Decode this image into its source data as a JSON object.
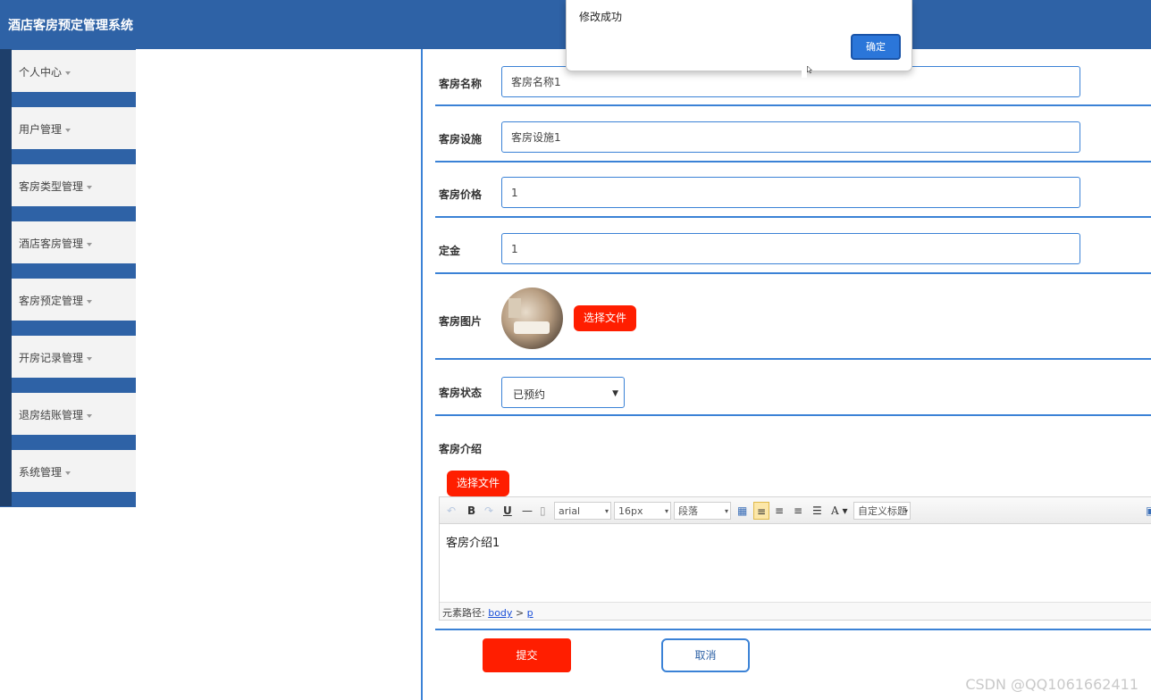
{
  "app": {
    "title": "酒店客房预定管理系统"
  },
  "sidebar": {
    "items": [
      {
        "label": "个人中心"
      },
      {
        "label": "用户管理"
      },
      {
        "label": "客房类型管理"
      },
      {
        "label": "酒店客房管理"
      },
      {
        "label": "客房预定管理"
      },
      {
        "label": "开房记录管理"
      },
      {
        "label": "退房结账管理"
      },
      {
        "label": "系统管理"
      }
    ]
  },
  "form": {
    "room_name": {
      "label": "客房名称",
      "value": "客房名称1"
    },
    "facilities": {
      "label": "客房设施",
      "value": "客房设施1"
    },
    "price": {
      "label": "客房价格",
      "value": "1"
    },
    "deposit": {
      "label": "定金",
      "value": "1"
    },
    "image": {
      "label": "客房图片",
      "upload_label": "选择文件"
    },
    "status": {
      "label": "客房状态",
      "selected": "已预约"
    },
    "intro": {
      "label": "客房介绍",
      "upload_label": "选择文件",
      "content": "客房介绍1"
    },
    "submit_label": "提交",
    "cancel_label": "取消"
  },
  "editor": {
    "font_family": "arial",
    "font_size": "16px",
    "paragraph": "段落",
    "custom_title": "自定义标题",
    "path_label": "元素路径:",
    "path_body": "body",
    "path_sep": ">",
    "path_p": "p"
  },
  "dialog": {
    "message": "修改成功",
    "ok_label": "确定"
  },
  "watermark": "CSDN @QQ1061662411"
}
